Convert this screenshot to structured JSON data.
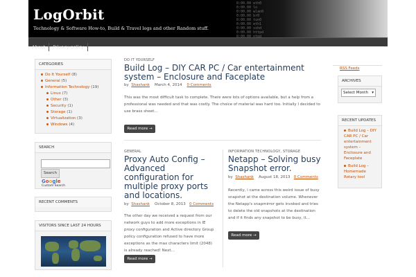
{
  "site": {
    "title": "LogOrbit",
    "tagline": "Technology & Software How-to, Build & Travel logs and other Random stuff.",
    "code_lines": "0:00.00 eth0\n0:00.00 lo\n0:00.00 wlan0\n0:00.00 br0\n0:00.00 tun0\n0:00.00 eth1\n0:00.00 sshd\n0:00.00 httpd\n0:00.00 ntpd"
  },
  "nav": [
    "About",
    "Privacy policy"
  ],
  "categories": {
    "title": "CATEGORIES",
    "items": [
      {
        "label": "Do It Yourself",
        "count": "(8)",
        "sub": false
      },
      {
        "label": "General",
        "count": "(5)",
        "sub": false
      },
      {
        "label": "Information Technology",
        "count": "(19)",
        "sub": false
      },
      {
        "label": "Linux",
        "count": "(7)",
        "sub": true
      },
      {
        "label": "Other",
        "count": "(3)",
        "sub": true
      },
      {
        "label": "Security",
        "count": "(1)",
        "sub": true
      },
      {
        "label": "Storage",
        "count": "(1)",
        "sub": true
      },
      {
        "label": "Virtualization",
        "count": "(3)",
        "sub": true
      },
      {
        "label": "Windows",
        "count": "(4)",
        "sub": true
      }
    ]
  },
  "search": {
    "title": "SEARCH",
    "button": "Search",
    "google": "Google",
    "custom": "Custom Search"
  },
  "recent_comments": {
    "title": "RECENT COMMENTS"
  },
  "visitors": {
    "title": "VISITORS SINCE LAST 24 HOURS"
  },
  "rss": {
    "label": "RSS Feeds"
  },
  "archives": {
    "title": "ARCHIVES",
    "select": "Select Month"
  },
  "recent_updates": {
    "title": "RECENT UPDATES",
    "items": [
      "Build Log – DIY CAR PC / Car entertainment system – Enclosure and Faceplate",
      "Build Log – Homemade Rotary tool"
    ]
  },
  "post1": {
    "category": "DO IT YOURSELF",
    "title": "Build Log – DIY CAR PC / Car entertainment system – Enclosure and Faceplate",
    "by": "by",
    "author": "Shashank",
    "date": "March 4, 2014",
    "comments": "0 Comments",
    "excerpt": "This was the most difficult task to complete. There were lots of options available, but a help from a professional was needed and that was costly. The choice of material was hard too. Initially I decided to use brass sheet…",
    "readmore": "Read more →"
  },
  "post2": {
    "category": "GENERAL",
    "title": "Proxy Auto Config – Advanced configuration for multiple proxy ports and locations.",
    "by": "by",
    "author": "Shashank",
    "date": "October 8, 2013",
    "comments": "0 Comments",
    "excerpt": "The other day we received a request from our network guys to add more exceptions in IE proxy configuration and Active directory Group policy configuration refused to have more exceptions as the max characters limit (2048) is already reached! Next…",
    "readmore": "Read more →"
  },
  "post3": {
    "category": "INFORMATION TECHNOLOGY, STORAGE",
    "title": "Netapp – Solving busy Snapshot error.",
    "by": "by",
    "author": "Shashank",
    "date": "August 18, 2013",
    "comments": "0 Comments",
    "excerpt": "Recently, i came across this weird issue of busy snapshot at the destination volume. Whenever the Netapp's snapmirror gets invoked and tries to delete the old snapshots at the destination and if it finds any snapshot to be busy, it…",
    "readmore": "Read more →"
  }
}
